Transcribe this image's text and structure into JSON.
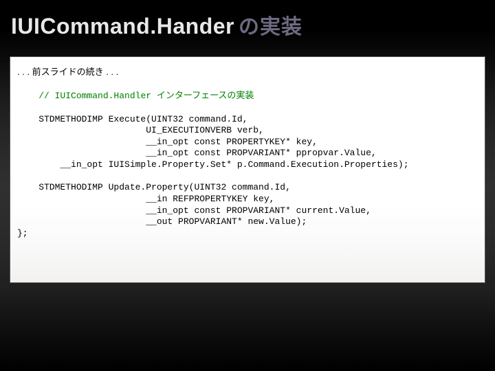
{
  "title": {
    "main": "IUICommand.Hander",
    "sub": "の実装"
  },
  "code": {
    "continuation": ". . . 前スライドの続き . . .",
    "comment_prefix": "// IUICommand.Handler ",
    "comment_jp": "インターフェースの実装",
    "execute": "    STDMETHODIMP Execute(UINT32 command.Id,\n                        UI_EXECUTIONVERB verb,\n                        __in_opt const PROPERTYKEY* key,\n                        __in_opt const PROPVARIANT* ppropvar.Value,\n        __in_opt IUISimple.Property.Set* p.Command.Execution.Properties);",
    "update": "    STDMETHODIMP Update.Property(UINT32 command.Id,\n                        __in REFPROPERTYKEY key,\n                        __in_opt const PROPVARIANT* current.Value,\n                        __out PROPVARIANT* new.Value);\n};"
  }
}
